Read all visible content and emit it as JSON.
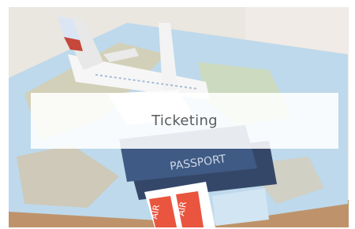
{
  "card": {
    "title": "Ticketing",
    "image_semantic": "travel-photo",
    "passport_text": "PASSPORT",
    "ticket_text": "AIR",
    "colors": {
      "map_blue": "#9cc3df",
      "passport_navy": "#28406a",
      "ticket_red": "#e8472f",
      "label_text": "#5b5b5b"
    }
  }
}
